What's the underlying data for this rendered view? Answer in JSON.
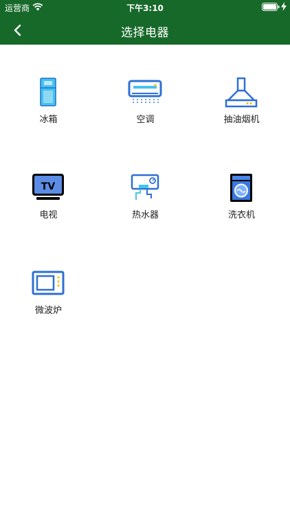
{
  "status_bar": {
    "carrier": "运营商",
    "time": "下午3:10"
  },
  "nav": {
    "title": "选择电器",
    "back_icon": "chevron-left-icon"
  },
  "appliances": [
    {
      "label": "冰箱",
      "icon": "fridge-icon"
    },
    {
      "label": "空调",
      "icon": "air-conditioner-icon"
    },
    {
      "label": "抽油烟机",
      "icon": "range-hood-icon"
    },
    {
      "label": "电视",
      "icon": "tv-icon"
    },
    {
      "label": "热水器",
      "icon": "water-heater-icon"
    },
    {
      "label": "洗衣机",
      "icon": "washing-machine-icon"
    },
    {
      "label": "微波炉",
      "icon": "microwave-icon"
    }
  ],
  "colors": {
    "header": "#17692a",
    "icon_blue": "#2e6fd4",
    "icon_light": "#45c3ef"
  }
}
